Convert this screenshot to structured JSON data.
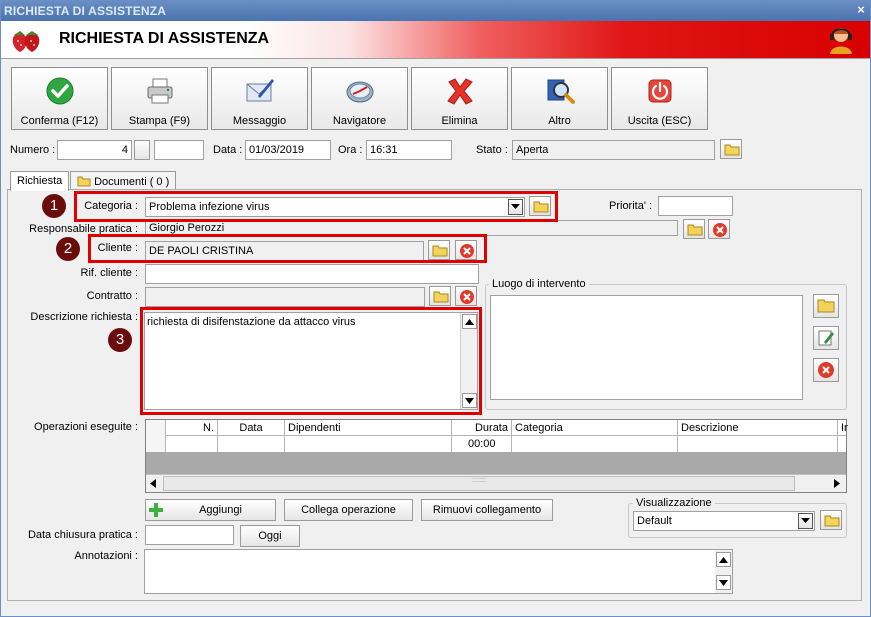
{
  "window": {
    "title": "RICHIESTA DI ASSISTENZA",
    "close": "×"
  },
  "header": {
    "title": "RICHIESTA DI ASSISTENZA"
  },
  "toolbar": [
    {
      "label": "Conferma (F12)",
      "icon": "check-icon"
    },
    {
      "label": "Stampa (F9)",
      "icon": "printer-icon"
    },
    {
      "label": "Messaggio",
      "icon": "envelope-pen-icon"
    },
    {
      "label": "Navigatore",
      "icon": "compass-icon"
    },
    {
      "label": "Elimina",
      "icon": "delete-x-icon"
    },
    {
      "label": "Altro",
      "icon": "magnifier-icon"
    },
    {
      "label": "Uscita (ESC)",
      "icon": "power-icon"
    }
  ],
  "info": {
    "numero_label": "Numero :",
    "numero_value": "4",
    "data_label": "Data :",
    "data_value": "01/03/2019",
    "ora_label": "Ora :",
    "ora_value": "16:31",
    "stato_label": "Stato :",
    "stato_value": "Aperta"
  },
  "tabs": [
    {
      "label": "Richiesta"
    },
    {
      "label": "Documenti ( 0 )"
    }
  ],
  "form": {
    "categoria_label": "Categoria :",
    "categoria_value": "Problema infezione virus",
    "priorita_label": "Priorita' :",
    "responsabile_label": "Responsabile pratica :",
    "responsabile_value": "Giorgio Perozzi",
    "cliente_label": "Cliente :",
    "cliente_value": "DE PAOLI CRISTINA",
    "rif_cliente_label": "Rif. cliente :",
    "contratto_label": "Contratto :",
    "descrizione_label": "Descrizione richiesta :",
    "descrizione_value": "richiesta di disifenstazione da attacco virus",
    "luogo_label": "Luogo di intervento",
    "operazioni_label": "Operazioni eseguite :",
    "data_chiusura_label": "Data chiusura pratica :",
    "annotazioni_label": "Annotazioni :",
    "visualizzazione_label": "Visualizzazione",
    "visualizzazione_value": "Default"
  },
  "grid": {
    "columns": [
      "N.",
      "Data",
      "Dipendenti",
      "Durata",
      "Categoria",
      "Descrizione",
      "In"
    ],
    "rows": [
      {
        "durata": "00:00"
      }
    ]
  },
  "buttons": {
    "aggiungi": "Aggiungi",
    "collega": "Collega operazione",
    "rimuovi": "Rimuovi collegamento",
    "oggi": "Oggi"
  },
  "annotations": [
    "1",
    "2",
    "3"
  ],
  "colors": {
    "highlight": "#e00000",
    "badge": "#6a0c0c",
    "title_bar": "#4a73b0"
  }
}
